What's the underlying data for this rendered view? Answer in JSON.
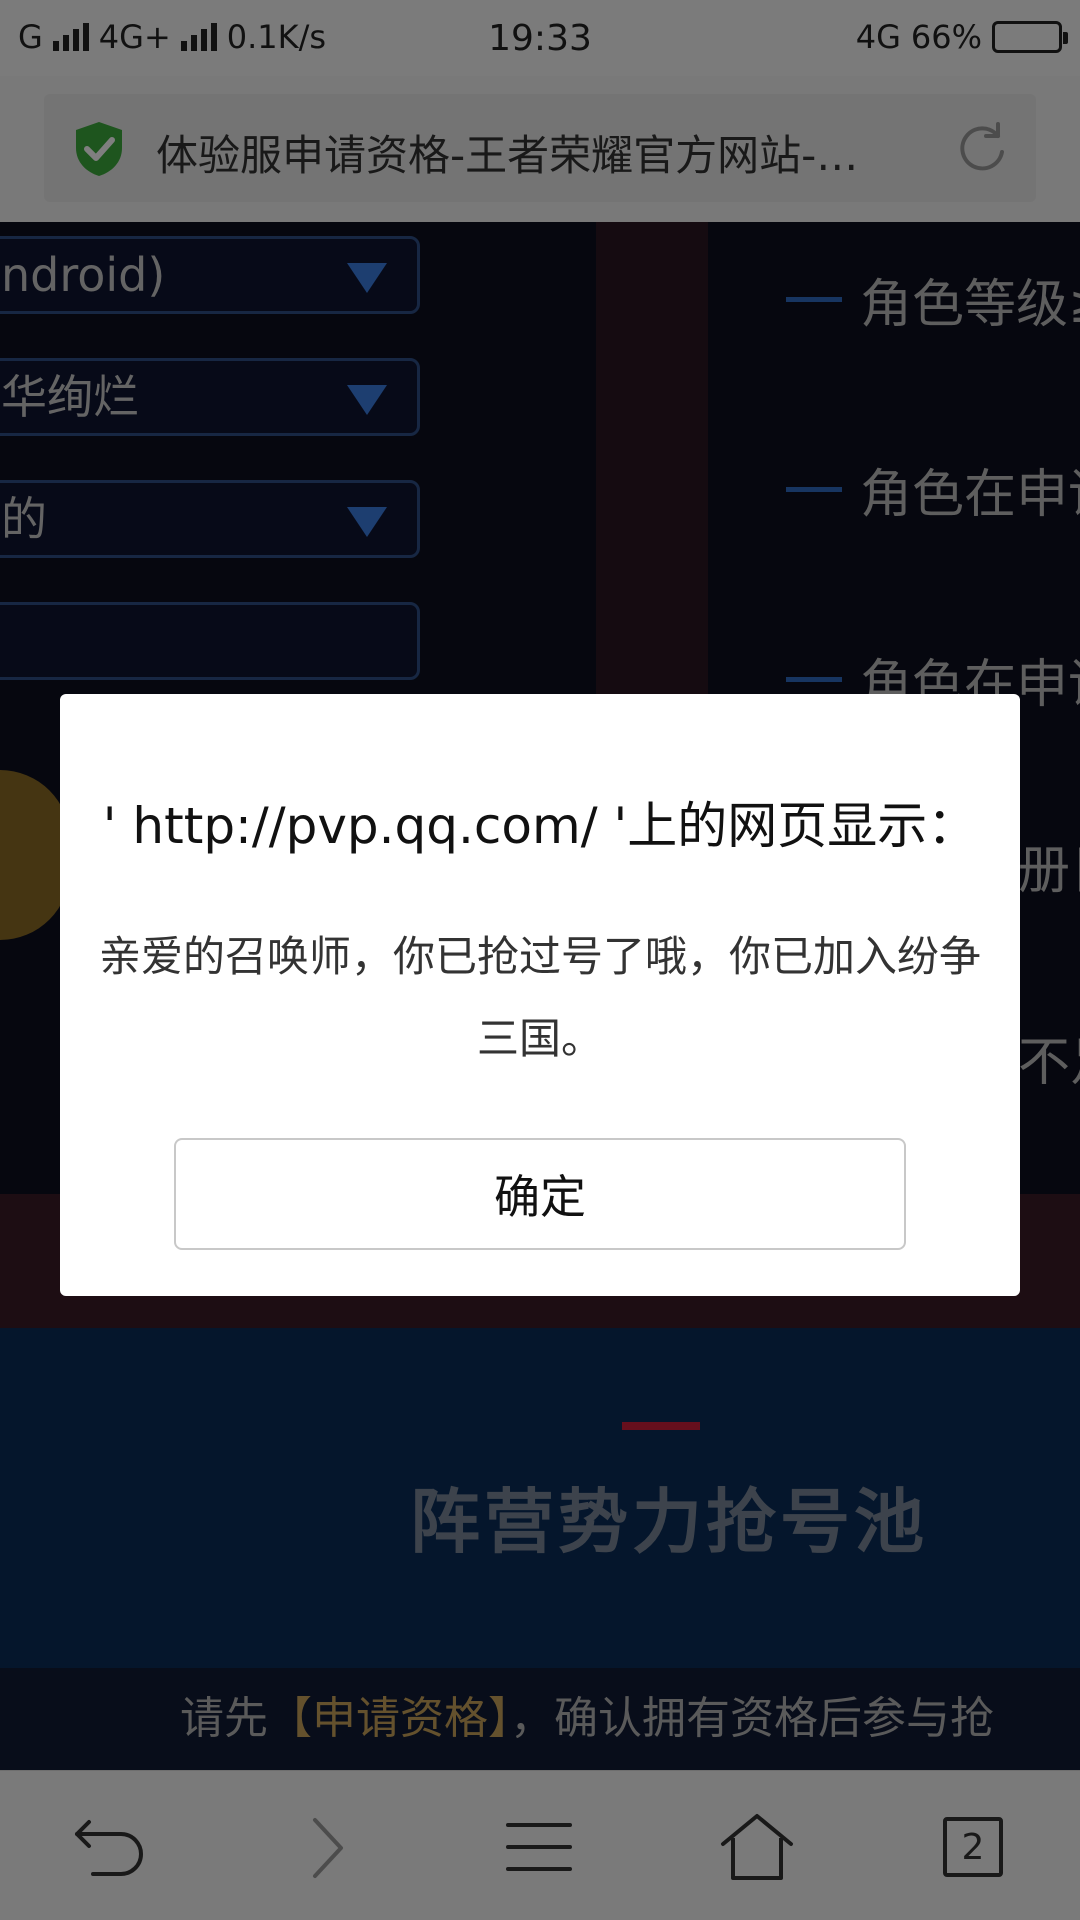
{
  "status_bar": {
    "carrier": "G",
    "network": "4G+",
    "speed": "0.1K/s",
    "time": "19:33",
    "network_right": "4G",
    "battery": "66%"
  },
  "address_bar": {
    "title": "体验服申请资格-王者荣耀官方网站-…",
    "shield_color": "#3cab3c"
  },
  "page": {
    "fields": [
      {
        "value": "ndroid)"
      },
      {
        "value": "华绚烂"
      },
      {
        "value": "的"
      },
      {
        "value": ""
      }
    ],
    "requirements": [
      {
        "text": "角色等级≥"
      },
      {
        "text": "角色在申请"
      },
      {
        "text": "角色在申请"
      },
      {
        "text": "册日"
      },
      {
        "text": "不足"
      }
    ],
    "section_heading": "阵营势力抢号池",
    "notice": {
      "prefix": "请先",
      "link": "【申请资格】",
      "suffix": "，确认拥有资格后参与抢"
    }
  },
  "dialog": {
    "title": "' http://pvp.qq.com/ '上的网页显示：",
    "message": "亲爱的召唤师，你已抢过号了哦，你已加入纷争三国。",
    "ok_label": "确定"
  },
  "toolbar": {
    "tab_count": "2"
  }
}
